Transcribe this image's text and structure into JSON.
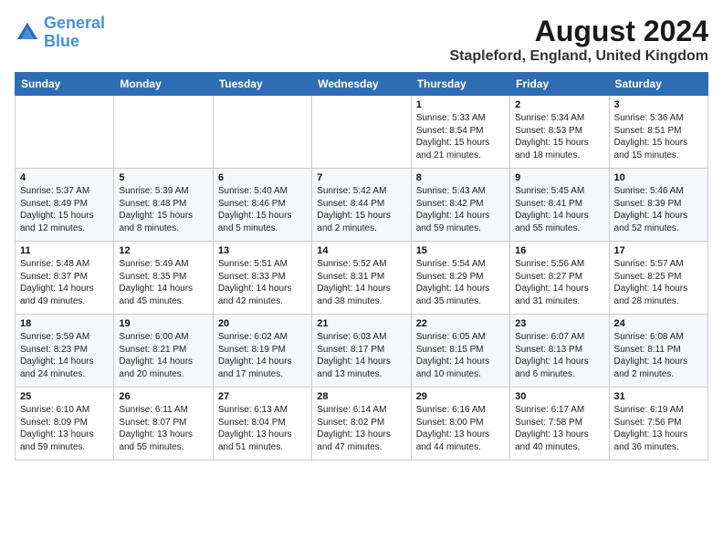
{
  "logo": {
    "line1": "General",
    "line2": "Blue"
  },
  "title": "August 2024",
  "subtitle": "Stapleford, England, United Kingdom",
  "headers": [
    "Sunday",
    "Monday",
    "Tuesday",
    "Wednesday",
    "Thursday",
    "Friday",
    "Saturday"
  ],
  "weeks": [
    [
      {
        "day": "",
        "info": ""
      },
      {
        "day": "",
        "info": ""
      },
      {
        "day": "",
        "info": ""
      },
      {
        "day": "",
        "info": ""
      },
      {
        "day": "1",
        "info": "Sunrise: 5:33 AM\nSunset: 8:54 PM\nDaylight: 15 hours\nand 21 minutes."
      },
      {
        "day": "2",
        "info": "Sunrise: 5:34 AM\nSunset: 8:53 PM\nDaylight: 15 hours\nand 18 minutes."
      },
      {
        "day": "3",
        "info": "Sunrise: 5:36 AM\nSunset: 8:51 PM\nDaylight: 15 hours\nand 15 minutes."
      }
    ],
    [
      {
        "day": "4",
        "info": "Sunrise: 5:37 AM\nSunset: 8:49 PM\nDaylight: 15 hours\nand 12 minutes."
      },
      {
        "day": "5",
        "info": "Sunrise: 5:39 AM\nSunset: 8:48 PM\nDaylight: 15 hours\nand 8 minutes."
      },
      {
        "day": "6",
        "info": "Sunrise: 5:40 AM\nSunset: 8:46 PM\nDaylight: 15 hours\nand 5 minutes."
      },
      {
        "day": "7",
        "info": "Sunrise: 5:42 AM\nSunset: 8:44 PM\nDaylight: 15 hours\nand 2 minutes."
      },
      {
        "day": "8",
        "info": "Sunrise: 5:43 AM\nSunset: 8:42 PM\nDaylight: 14 hours\nand 59 minutes."
      },
      {
        "day": "9",
        "info": "Sunrise: 5:45 AM\nSunset: 8:41 PM\nDaylight: 14 hours\nand 55 minutes."
      },
      {
        "day": "10",
        "info": "Sunrise: 5:46 AM\nSunset: 8:39 PM\nDaylight: 14 hours\nand 52 minutes."
      }
    ],
    [
      {
        "day": "11",
        "info": "Sunrise: 5:48 AM\nSunset: 8:37 PM\nDaylight: 14 hours\nand 49 minutes."
      },
      {
        "day": "12",
        "info": "Sunrise: 5:49 AM\nSunset: 8:35 PM\nDaylight: 14 hours\nand 45 minutes."
      },
      {
        "day": "13",
        "info": "Sunrise: 5:51 AM\nSunset: 8:33 PM\nDaylight: 14 hours\nand 42 minutes."
      },
      {
        "day": "14",
        "info": "Sunrise: 5:52 AM\nSunset: 8:31 PM\nDaylight: 14 hours\nand 38 minutes."
      },
      {
        "day": "15",
        "info": "Sunrise: 5:54 AM\nSunset: 8:29 PM\nDaylight: 14 hours\nand 35 minutes."
      },
      {
        "day": "16",
        "info": "Sunrise: 5:56 AM\nSunset: 8:27 PM\nDaylight: 14 hours\nand 31 minutes."
      },
      {
        "day": "17",
        "info": "Sunrise: 5:57 AM\nSunset: 8:25 PM\nDaylight: 14 hours\nand 28 minutes."
      }
    ],
    [
      {
        "day": "18",
        "info": "Sunrise: 5:59 AM\nSunset: 8:23 PM\nDaylight: 14 hours\nand 24 minutes."
      },
      {
        "day": "19",
        "info": "Sunrise: 6:00 AM\nSunset: 8:21 PM\nDaylight: 14 hours\nand 20 minutes."
      },
      {
        "day": "20",
        "info": "Sunrise: 6:02 AM\nSunset: 8:19 PM\nDaylight: 14 hours\nand 17 minutes."
      },
      {
        "day": "21",
        "info": "Sunrise: 6:03 AM\nSunset: 8:17 PM\nDaylight: 14 hours\nand 13 minutes."
      },
      {
        "day": "22",
        "info": "Sunrise: 6:05 AM\nSunset: 8:15 PM\nDaylight: 14 hours\nand 10 minutes."
      },
      {
        "day": "23",
        "info": "Sunrise: 6:07 AM\nSunset: 8:13 PM\nDaylight: 14 hours\nand 6 minutes."
      },
      {
        "day": "24",
        "info": "Sunrise: 6:08 AM\nSunset: 8:11 PM\nDaylight: 14 hours\nand 2 minutes."
      }
    ],
    [
      {
        "day": "25",
        "info": "Sunrise: 6:10 AM\nSunset: 8:09 PM\nDaylight: 13 hours\nand 59 minutes."
      },
      {
        "day": "26",
        "info": "Sunrise: 6:11 AM\nSunset: 8:07 PM\nDaylight: 13 hours\nand 55 minutes."
      },
      {
        "day": "27",
        "info": "Sunrise: 6:13 AM\nSunset: 8:04 PM\nDaylight: 13 hours\nand 51 minutes."
      },
      {
        "day": "28",
        "info": "Sunrise: 6:14 AM\nSunset: 8:02 PM\nDaylight: 13 hours\nand 47 minutes."
      },
      {
        "day": "29",
        "info": "Sunrise: 6:16 AM\nSunset: 8:00 PM\nDaylight: 13 hours\nand 44 minutes."
      },
      {
        "day": "30",
        "info": "Sunrise: 6:17 AM\nSunset: 7:58 PM\nDaylight: 13 hours\nand 40 minutes."
      },
      {
        "day": "31",
        "info": "Sunrise: 6:19 AM\nSunset: 7:56 PM\nDaylight: 13 hours\nand 36 minutes."
      }
    ]
  ]
}
